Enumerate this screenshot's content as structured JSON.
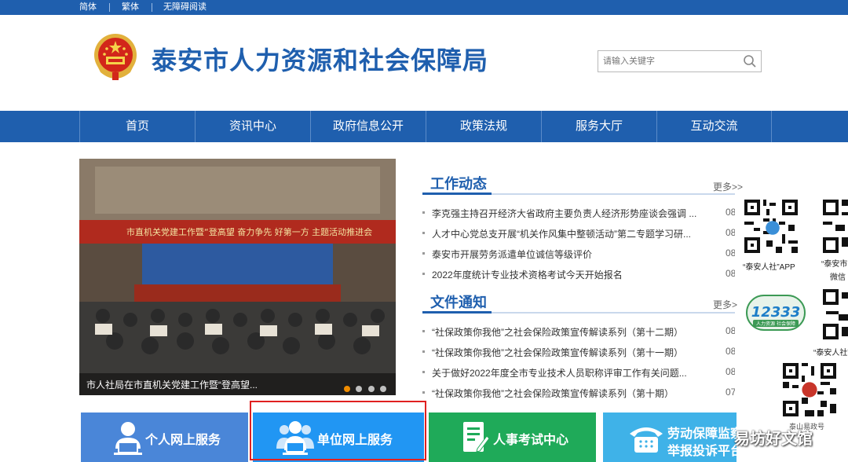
{
  "topbar": {
    "simplified": "简体",
    "traditional": "繁体",
    "accessible": "无障碍阅读"
  },
  "header": {
    "title": "泰安市人力资源和社会保障局",
    "search_placeholder": "请输入关键字"
  },
  "nav": [
    "首页",
    "资讯中心",
    "政府信息公开",
    "政策法规",
    "服务大厅",
    "互动交流"
  ],
  "slideshow": {
    "caption": "市人社局在市直机关党建工作暨“登高望...",
    "banner_text": "市直机关党建工作暨“登高望   奋力争先   好第一方   主题活动推进会",
    "dots": 4,
    "active_dot": 0
  },
  "work_news": {
    "title": "工作动态",
    "more": "更多>>",
    "items": [
      {
        "text": "李克强主持召开经济大省政府主要负责人经济形势座谈会强调 ...",
        "date": "08"
      },
      {
        "text": "人才中心党总支开展“机关作风集中整顿活动”第二专题学习研...",
        "date": "08"
      },
      {
        "text": "泰安市开展劳务派遣单位诚信等级评价",
        "date": "08"
      },
      {
        "text": "2022年度统计专业技术资格考试今天开始报名",
        "date": "08"
      }
    ]
  },
  "file_notices": {
    "title": "文件通知",
    "more": "更多>",
    "items": [
      {
        "text": "“社保政策你我他”之社会保险政策宣传解读系列（第十二期）",
        "date": "08"
      },
      {
        "text": "“社保政策你我他”之社会保险政策宣传解读系列（第十一期）",
        "date": "08"
      },
      {
        "text": "关于做好2022年度全市专业技术人员职称评审工作有关问题...",
        "date": "08"
      },
      {
        "text": "“社保政策你我他”之社会保险政策宣传解读系列（第十期）",
        "date": "07"
      }
    ]
  },
  "sidebar": {
    "qr_app_label": "“泰安人社”APP",
    "qr_wechat_label_1": "“泰安市",
    "qr_wechat_label_2": "微信",
    "qr_third_label": "“泰安人社”",
    "qr_bottom_label": "泰山易政号",
    "badge": {
      "number": "12333",
      "slogan": "人力资源 社会保障"
    }
  },
  "services": [
    {
      "label": "个人网上服务",
      "color": "#4a86d8",
      "icon": "person-computer-icon"
    },
    {
      "label": "单位网上服务",
      "color": "#2196f3",
      "icon": "group-computer-icon"
    },
    {
      "label": "人事考试中心",
      "color": "#1faa59",
      "icon": "exam-document-icon"
    },
    {
      "label": "劳动保障监察",
      "label2": "举报投诉平台",
      "color": "#3fb2e8",
      "icon": "telephone-icon"
    }
  ],
  "watermark": "易坊好文馆"
}
